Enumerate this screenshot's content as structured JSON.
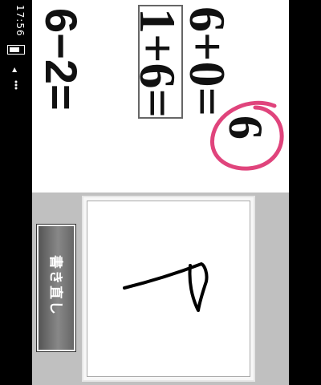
{
  "status_bar": {
    "time": "17:56"
  },
  "problems": [
    {
      "expr": "6−2="
    },
    {
      "expr": "1+6="
    },
    {
      "expr": "6+0="
    }
  ],
  "answers": [
    {
      "value": "6"
    }
  ],
  "controls": {
    "rewrite_label": "書き直し"
  },
  "colors": {
    "answer_pink": "#e0447c",
    "background_gray": "#c0c0c0"
  }
}
